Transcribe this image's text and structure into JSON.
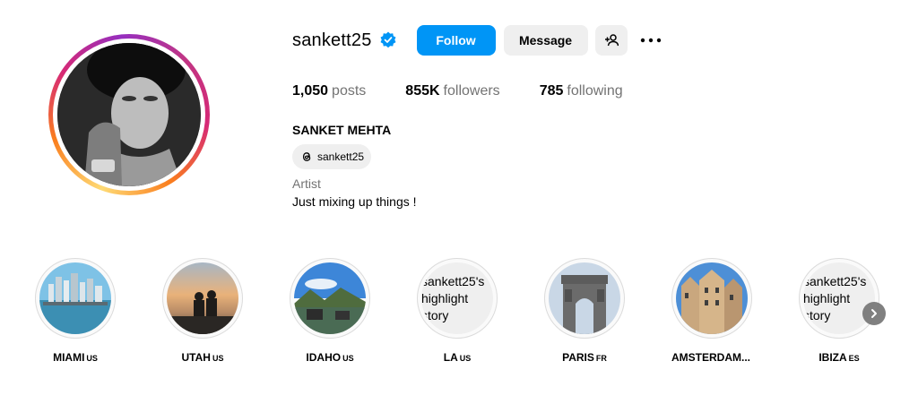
{
  "profile": {
    "username": "sankett25",
    "verified": true,
    "follow_label": "Follow",
    "message_label": "Message",
    "stats": {
      "posts_count": "1,050",
      "posts_label": "posts",
      "followers_count": "855K",
      "followers_label": "followers",
      "following_count": "785",
      "following_label": "following"
    },
    "full_name": "SANKET MEHTA",
    "threads_handle": "sankett25",
    "category": "Artist",
    "bio": "Just mixing up things !"
  },
  "highlights": [
    {
      "name": "MIAMI",
      "country": "US",
      "image": "city-skyline-waterfront"
    },
    {
      "name": "UTAH",
      "country": "US",
      "image": "sunset-couple"
    },
    {
      "name": "IDAHO",
      "country": "US",
      "image": "mountain-lake"
    },
    {
      "name": "LA",
      "country": "US",
      "alt_text": "sankett25's highlight story"
    },
    {
      "name": "PARIS",
      "country": "FR",
      "image": "arc-de-triomphe"
    },
    {
      "name": "AMSTERDAM...",
      "country": "",
      "image": "canal-houses"
    },
    {
      "name": "IBIZA",
      "country": "ES",
      "alt_text": "sankett25's highlight story"
    }
  ],
  "colors": {
    "follow_blue": "#0095f6",
    "secondary_button": "#efefef",
    "muted_text": "#737373",
    "verified_blue": "#0095f6"
  },
  "icons": [
    "verified-badge-icon",
    "add-person-icon",
    "more-options-icon",
    "threads-icon",
    "next-arrow-icon"
  ]
}
